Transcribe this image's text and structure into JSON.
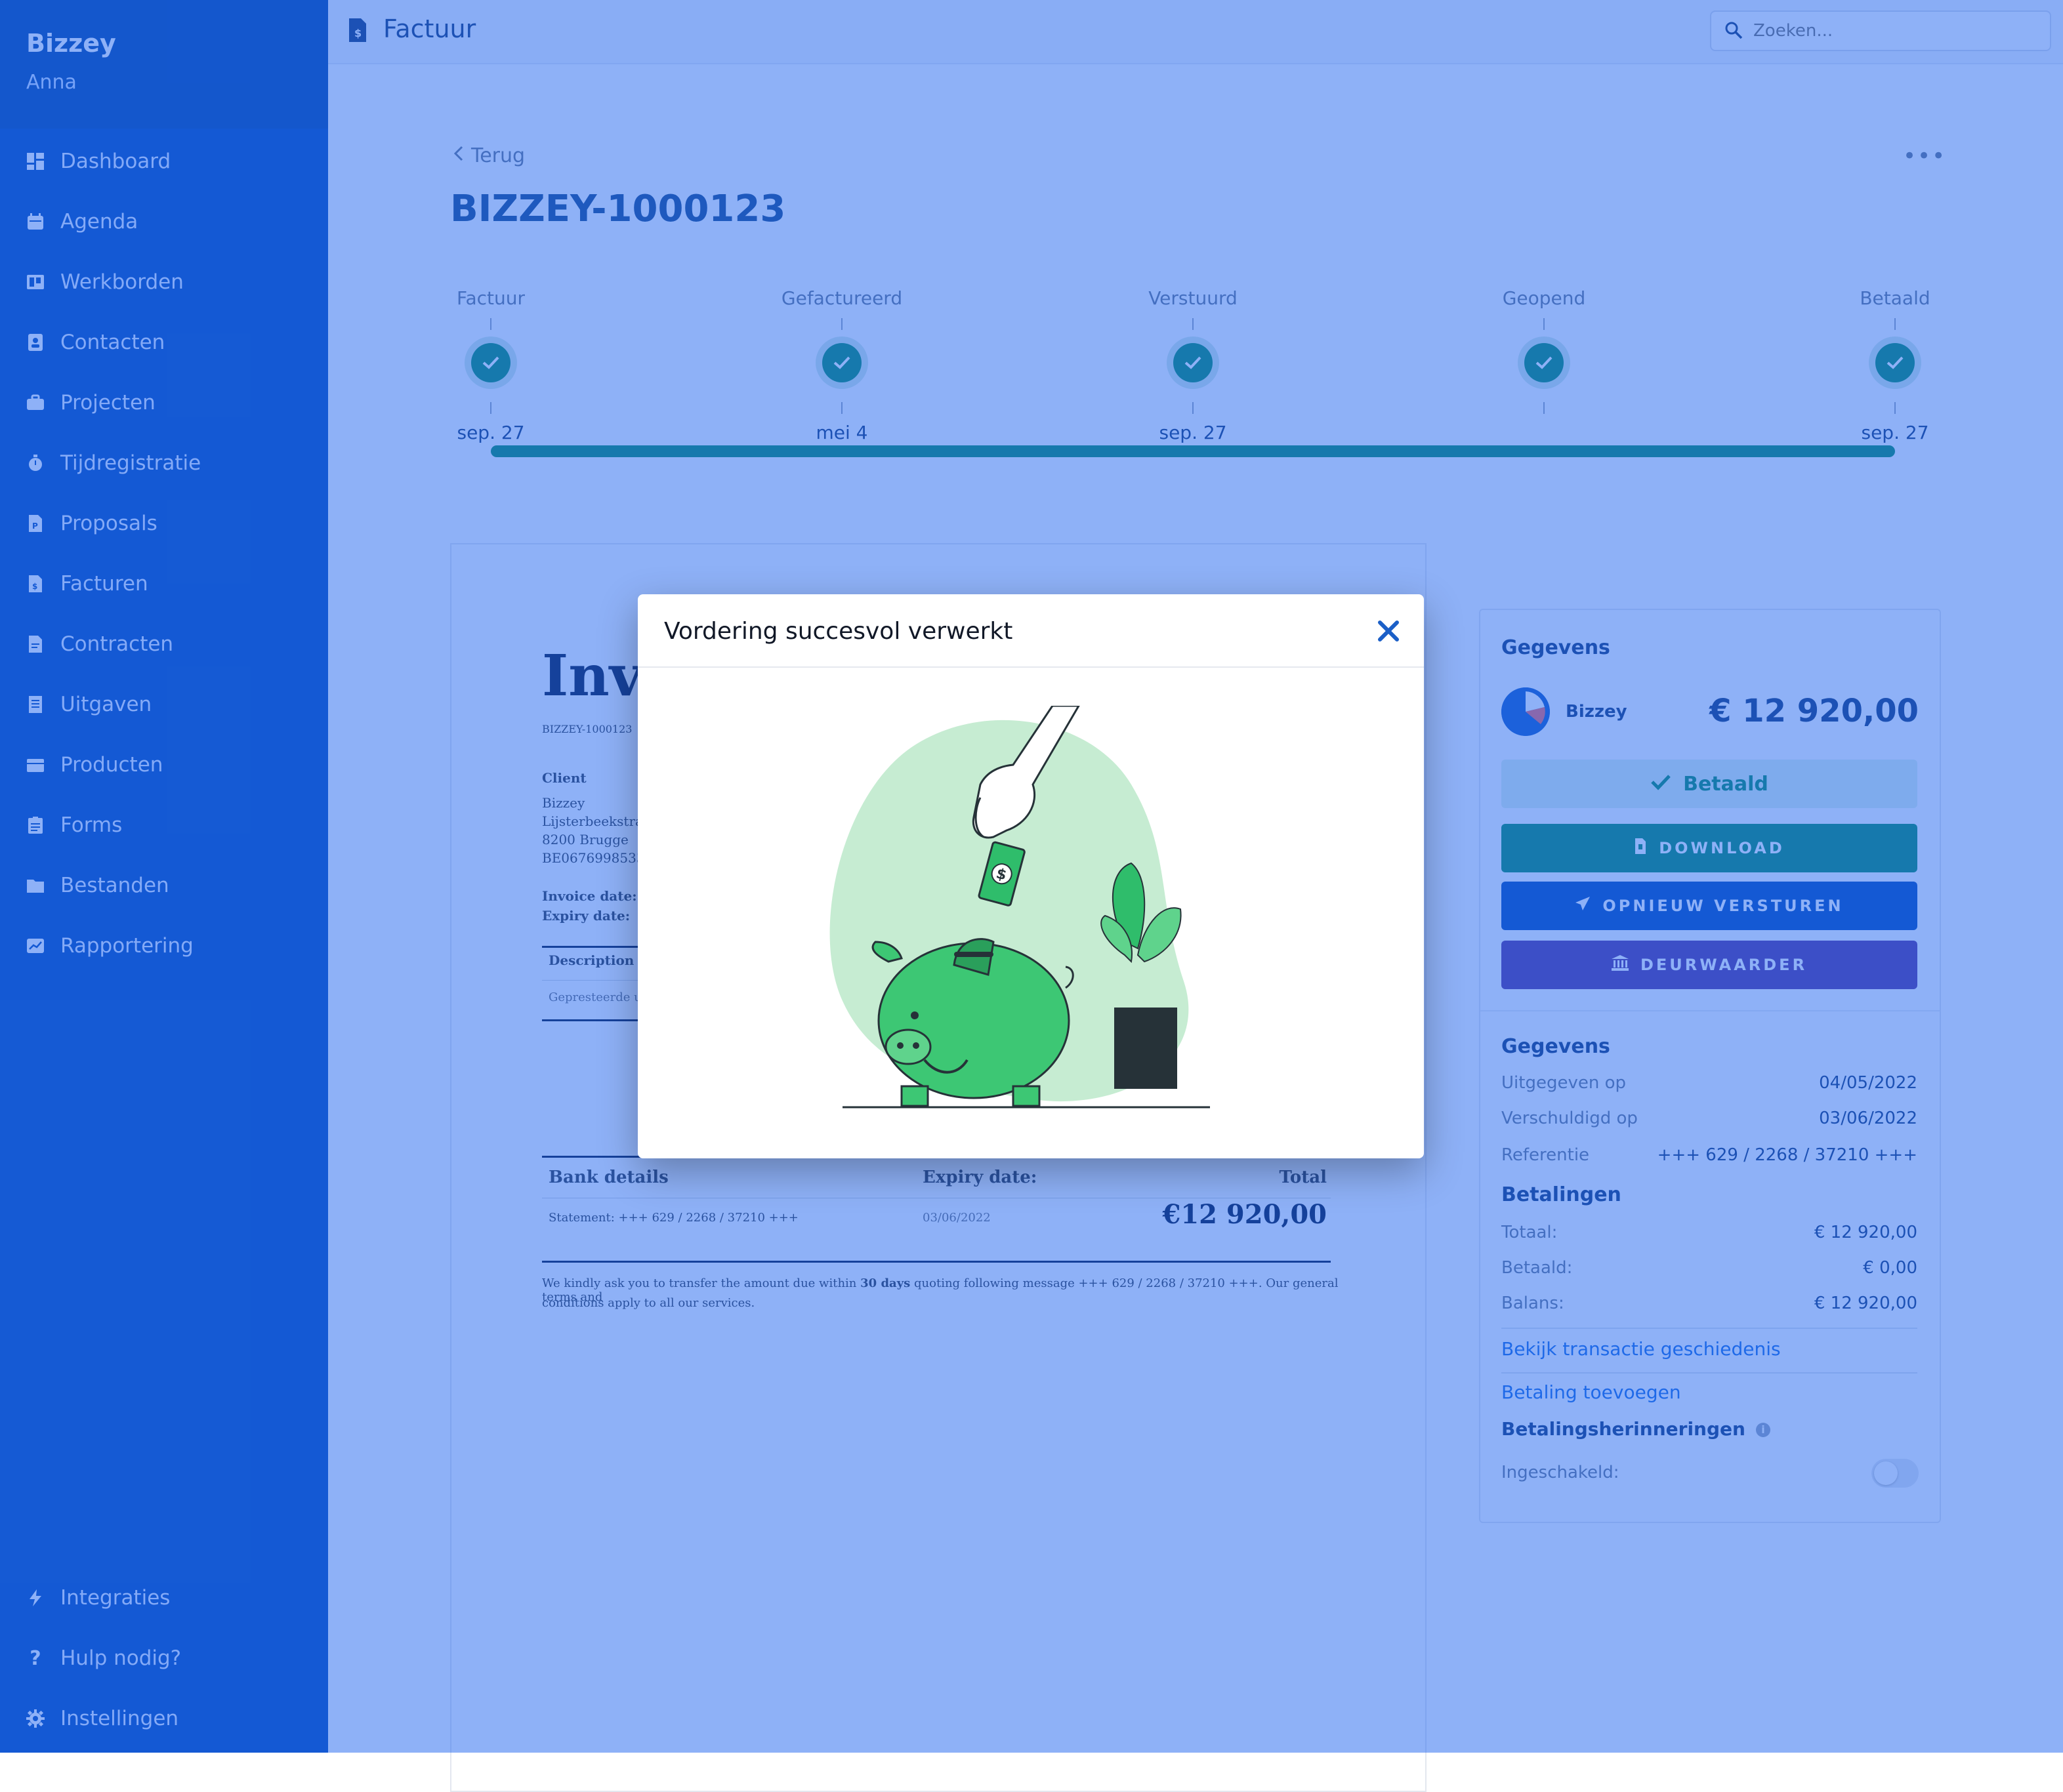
{
  "app": {
    "brand": "Bizzey",
    "user": "Anna"
  },
  "sidebar": {
    "items": [
      {
        "label": "Dashboard",
        "icon": "dashboard-icon"
      },
      {
        "label": "Agenda",
        "icon": "calendar-icon"
      },
      {
        "label": "Werkborden",
        "icon": "board-icon"
      },
      {
        "label": "Contacten",
        "icon": "contact-icon"
      },
      {
        "label": "Projecten",
        "icon": "briefcase-icon"
      },
      {
        "label": "Tijdregistratie",
        "icon": "stopwatch-icon"
      },
      {
        "label": "Proposals",
        "icon": "proposal-icon"
      },
      {
        "label": "Facturen",
        "icon": "invoice-icon"
      },
      {
        "label": "Contracten",
        "icon": "contract-icon"
      },
      {
        "label": "Uitgaven",
        "icon": "receipt-icon"
      },
      {
        "label": "Producten",
        "icon": "box-icon"
      },
      {
        "label": "Forms",
        "icon": "form-icon"
      },
      {
        "label": "Bestanden",
        "icon": "folder-icon"
      },
      {
        "label": "Rapportering",
        "icon": "chart-icon"
      }
    ],
    "bottom": [
      {
        "label": "Integraties",
        "icon": "bolt-icon"
      },
      {
        "label": "Hulp nodig?",
        "icon": "question-icon"
      },
      {
        "label": "Instellingen",
        "icon": "gear-icon"
      }
    ]
  },
  "topbar": {
    "title": "Factuur",
    "search_placeholder": "Zoeken..."
  },
  "page": {
    "back": "Terug",
    "more": "•••",
    "invoice_number": "BIZZEY-1000123"
  },
  "timeline": [
    {
      "label": "Factuur",
      "date": "sep. 27"
    },
    {
      "label": "Gefactureerd",
      "date": "mei 4"
    },
    {
      "label": "Verstuurd",
      "date": "sep. 27"
    },
    {
      "label": "Geopend",
      "date": ""
    },
    {
      "label": "Betaald",
      "date": "sep. 27"
    }
  ],
  "invoice_preview": {
    "heading": "Invoice",
    "number": "BIZZEY-1000123",
    "client_label": "Client",
    "client_lines": [
      "Bizzey",
      "Lijsterbeekstraat",
      "8200 Brugge",
      "BE0676998533"
    ],
    "invoice_date_label": "Invoice date:",
    "expiry_date_label": "Expiry date:",
    "desc_header": "Description",
    "desc_row": "Gepresteerde uren",
    "bank_header": "Bank details",
    "expiry_header": "Expiry date:",
    "total_header": "Total",
    "statement": "Statement: +++ 629 / 2268 / 37210 +++",
    "expiry_value": "03/06/2022",
    "total_value": "€12 920,00",
    "footer_before": "We kindly ask you to transfer the amount due within ",
    "footer_days": "30 days",
    "footer_after": " quoting following message +++ 629 / 2268 / 37210 +++. Our general terms and",
    "footer_line2": "conditions apply to all our services."
  },
  "panel": {
    "title": "Gegevens",
    "contact_name": "Bizzey",
    "amount": "€ 12 920,00",
    "paid_button": "Betaald",
    "download_button": "DOWNLOAD",
    "resend_button": "OPNIEUW VERSTUREN",
    "collector_button": "DEURWAARDER",
    "details_title": "Gegevens",
    "details": [
      {
        "k": "Uitgegeven op",
        "v": "04/05/2022"
      },
      {
        "k": "Verschuldigd op",
        "v": "03/06/2022"
      },
      {
        "k": "Referentie",
        "v": "+++ 629 / 2268 / 37210 +++"
      }
    ],
    "payments_title": "Betalingen",
    "payments": [
      {
        "k": "Totaal:",
        "v": "€ 12 920,00"
      },
      {
        "k": "Betaald:",
        "v": "€ 0,00"
      },
      {
        "k": "Balans:",
        "v": "€ 12 920,00"
      }
    ],
    "history_link": "Bekijk transactie geschiedenis",
    "add_payment_link": "Betaling toevoegen",
    "reminders_title": "Betalingsherinneringen",
    "reminders_info": "i",
    "enabled_label": "Ingeschakeld:"
  },
  "modal": {
    "title": "Vordering succesvol verwerkt"
  },
  "colors": {
    "sidebar": "#0b4fb8",
    "success": "#0e8f6a",
    "overlay": "rgba(30,100,240,0.5)",
    "collector": "#5b3a9e"
  }
}
